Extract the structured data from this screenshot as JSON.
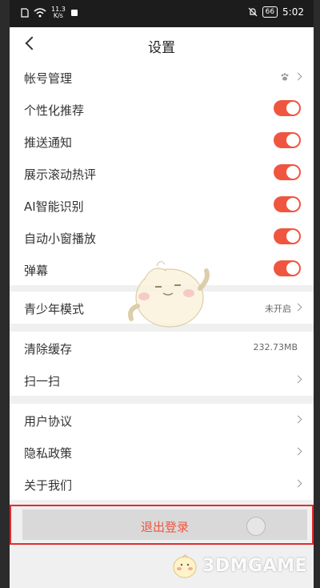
{
  "status_bar": {
    "speed_value": "11.3",
    "speed_unit": "K/s",
    "battery": "66",
    "time": "5:02"
  },
  "header": {
    "title": "设置"
  },
  "account": {
    "label": "帐号管理"
  },
  "toggles": [
    {
      "label": "个性化推荐",
      "on": true
    },
    {
      "label": "推送通知",
      "on": true
    },
    {
      "label": "展示滚动热评",
      "on": true
    },
    {
      "label": "AI智能识别",
      "on": true
    },
    {
      "label": "自动小窗播放",
      "on": true
    },
    {
      "label": "弹幕",
      "on": true
    }
  ],
  "youth_mode": {
    "label": "青少年模式",
    "value": "未开启"
  },
  "cache": {
    "label": "清除缓存",
    "value": "232.73MB"
  },
  "scan": {
    "label": "扫一扫"
  },
  "legal": [
    {
      "label": "用户协议"
    },
    {
      "label": "隐私政策"
    },
    {
      "label": "关于我们"
    }
  ],
  "logout": {
    "label": "退出登录"
  },
  "watermark": {
    "text": "3DMGAME"
  },
  "colors": {
    "accent": "#f0553f",
    "highlight_border": "#e52b2b",
    "background": "#f0f0f0"
  }
}
